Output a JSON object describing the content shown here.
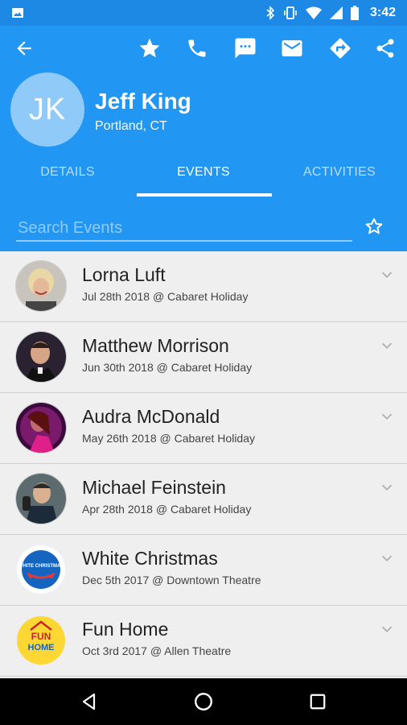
{
  "status_bar": {
    "time": "3:42"
  },
  "contact": {
    "initials": "JK",
    "name": "Jeff King",
    "location": "Portland, CT"
  },
  "tabs": [
    {
      "label": "DETAILS",
      "active": false
    },
    {
      "label": "EVENTS",
      "active": true
    },
    {
      "label": "ACTIVITIES",
      "active": false
    }
  ],
  "search": {
    "placeholder": "Search Events",
    "value": ""
  },
  "events": [
    {
      "name": "Lorna Luft",
      "meta": "Jul 28th 2018 @ Cabaret Holiday"
    },
    {
      "name": "Matthew Morrison",
      "meta": "Jun 30th 2018 @ Cabaret Holiday"
    },
    {
      "name": "Audra McDonald",
      "meta": "May 26th 2018 @ Cabaret Holiday"
    },
    {
      "name": "Michael Feinstein",
      "meta": "Apr 28th 2018 @ Cabaret Holiday"
    },
    {
      "name": "White Christmas",
      "meta": "Dec 5th 2017 @ Downtown Theatre"
    },
    {
      "name": "Fun Home",
      "meta": "Oct 3rd 2017 @ Allen Theatre"
    }
  ],
  "logos": {
    "white_christmas": "WHITE CHRISTMAS",
    "fun_home_1": "FUN",
    "fun_home_2": "HOME"
  },
  "colors": {
    "primary": "#2196f3",
    "status_bar": "#1e88e5",
    "avatar": "#90caf9"
  }
}
